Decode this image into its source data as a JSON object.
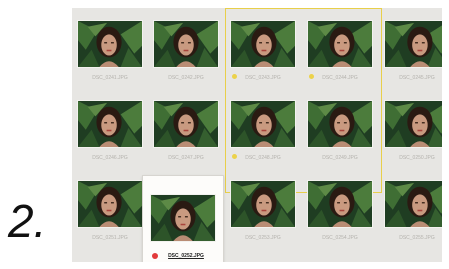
{
  "step_label": "2.",
  "thumbnail_labels": [
    "DSC_0241.JPG",
    "DSC_0242.JPG",
    "DSC_0243.JPG",
    "DSC_0244.JPG",
    "DSC_0245.JPG",
    "DSC_0246.JPG",
    "DSC_0247.JPG",
    "DSC_0248.JPG",
    "DSC_0249.JPG",
    "DSC_0250.JPG",
    "DSC_0251.JPG",
    "DSC_0252.JPG",
    "DSC_0253.JPG",
    "DSC_0254.JPG",
    "DSC_0255.JPG"
  ],
  "selected_label": "DSC_0252.JPG",
  "colors": {
    "panel_bg": "#e7e6e3",
    "selection_outline": "#e8cf4a",
    "flag": "#ecd24a",
    "reject": "#e23a3a"
  },
  "icons": {
    "flag": "pick-flag-icon",
    "reject": "reject-flag-icon"
  }
}
